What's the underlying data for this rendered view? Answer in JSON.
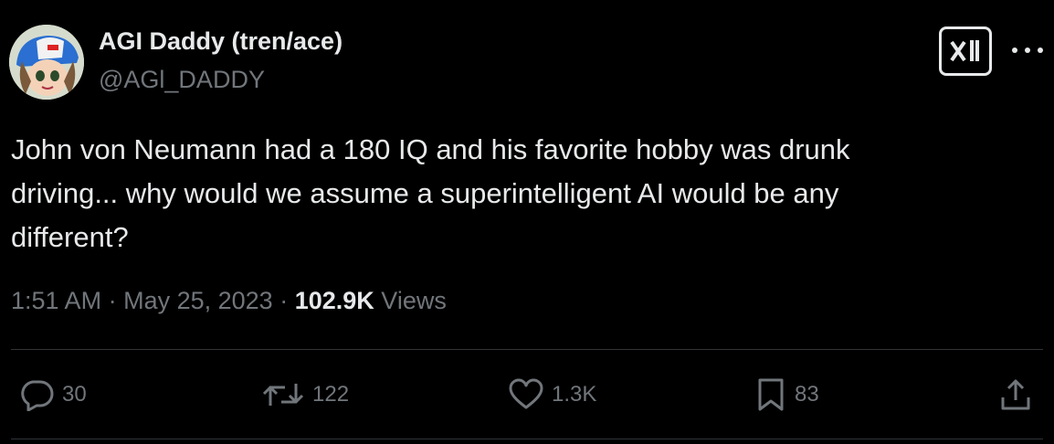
{
  "author": {
    "display_name": "AGI Daddy (tren/ace)",
    "handle": "@AGl_DADDY"
  },
  "tweet": {
    "text": "John von Neumann had a 180 IQ and his favorite hobby was drunk\ndriving... why would we assume a superintelligent AI would be any\ndifferent?",
    "time": "1:51 AM",
    "date": "May 25, 2023",
    "views_count": "102.9K",
    "views_label": "Views"
  },
  "actions": {
    "replies": "30",
    "retweets": "122",
    "likes": "1.3K",
    "bookmarks": "83"
  },
  "icons": {
    "brand": "xai-logo-icon",
    "more": "more-icon",
    "reply": "reply-icon",
    "retweet": "retweet-icon",
    "like": "heart-icon",
    "bookmark": "bookmark-icon",
    "share": "share-icon"
  },
  "colors": {
    "background": "#000000",
    "text": "#e7e9ea",
    "muted": "#71767b",
    "divider": "#2f3336"
  }
}
